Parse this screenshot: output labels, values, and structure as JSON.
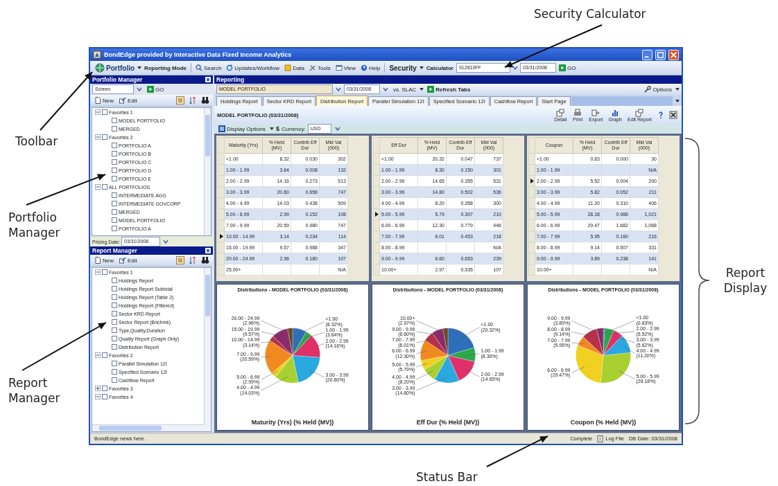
{
  "annotations": [
    {
      "text": "Security Calculator"
    },
    {
      "text": "Toolbar"
    },
    {
      "text": "Portfolio Manager"
    },
    {
      "text": "Report Manager"
    },
    {
      "text": "Report Display"
    },
    {
      "text": "Status Bar"
    }
  ],
  "window": {
    "title": "BondEdge provided by Interactive Data Fixed Income Analytics"
  },
  "toolbar": {
    "portfolio": "Portfolio",
    "mode": "Reporting Mode",
    "buttons": [
      {
        "label": "Search",
        "kind": "search"
      },
      {
        "label": "Updates/Workflow",
        "kind": "refresh"
      },
      {
        "label": "Data",
        "kind": "data"
      },
      {
        "label": "Tools",
        "kind": "tools"
      },
      {
        "label": "View",
        "kind": "view"
      },
      {
        "label": "Help",
        "kind": "help"
      }
    ],
    "security": "Security",
    "calculator": "Calculator",
    "security_value": "912810FF",
    "date_value": "03/31/2008",
    "go": "GO"
  },
  "portfolio_manager": {
    "title": "Portfolio Manager",
    "screen_value": "Screen",
    "go": "GO",
    "new": "New",
    "edit": "Edit",
    "tree": [
      {
        "label": "Favorites 1",
        "expanded": true,
        "checked": false,
        "children": [
          {
            "label": "MODEL PORTFOLIO",
            "checked": false
          },
          {
            "label": "MERGED",
            "checked": false
          }
        ]
      },
      {
        "label": "Favorites 2",
        "expanded": true,
        "checked": false,
        "children": [
          {
            "label": "PORTFOLIO A",
            "checked": false
          },
          {
            "label": "PORTFOLIO B",
            "checked": false
          },
          {
            "label": "PORTFOLIO C",
            "checked": false
          },
          {
            "label": "PORTFOLIO D",
            "checked": false
          },
          {
            "label": "PORTFOLIO E",
            "checked": false
          }
        ]
      },
      {
        "label": "ALL PORTFOLIOS",
        "expanded": true,
        "checked": false,
        "children": [
          {
            "label": "INTERMEDIATE AGG",
            "checked": false
          },
          {
            "label": "INTERMEDIATE GOVCORP",
            "checked": false
          },
          {
            "label": "MERGED",
            "checked": false
          },
          {
            "label": "MODEL PORTFOLIO",
            "checked": false
          },
          {
            "label": "PORTFOLIO A",
            "checked": false
          }
        ]
      }
    ],
    "pricing_label": "Pricing Date:",
    "pricing_value": "03/31/2008"
  },
  "report_manager": {
    "title": "Report Manager",
    "new": "New",
    "edit": "Edit",
    "tree": [
      {
        "label": "Favorites 1",
        "expanded": true,
        "checked": false,
        "children": [
          {
            "label": "Holdings Report",
            "checked": false
          },
          {
            "label": "Holdings Report Subtotal",
            "checked": false
          },
          {
            "label": "Holdings Report (Table 2)",
            "checked": false
          },
          {
            "label": "Holdings Report (Filtered)",
            "checked": false
          },
          {
            "label": "Sector KRD Report",
            "checked": false
          },
          {
            "label": "Sector Report (Bnchmk)",
            "checked": false
          },
          {
            "label": "Type,Quality,Duration",
            "checked": false
          },
          {
            "label": "Quality Report (Graph Only)",
            "checked": false
          },
          {
            "label": "Distribution Report",
            "checked": false
          }
        ]
      },
      {
        "label": "Favorites 2",
        "expanded": true,
        "checked": false,
        "children": [
          {
            "label": "Parallel Simulation 12I",
            "checked": false
          },
          {
            "label": "Specified Scenario 12I",
            "checked": false
          },
          {
            "label": "Cashflow Report",
            "checked": false
          }
        ]
      },
      {
        "label": "Favorites 3",
        "expanded": false,
        "checked": false
      },
      {
        "label": "Favorites 4",
        "expanded": true,
        "checked": false
      }
    ]
  },
  "reporting": {
    "title": "Reporting",
    "portfolio_value": "MODEL PORTFOLIO",
    "date_value": "03/31/2008",
    "vs": "vs. SLAC",
    "refresh": "Refresh Tabs",
    "options": "Options",
    "tabs": [
      {
        "label": "Holdings Report",
        "selected": false
      },
      {
        "label": "Sector KRD Report",
        "selected": false
      },
      {
        "label": "Distribution Report",
        "selected": true
      },
      {
        "label": "Parallel Simulation 12I",
        "selected": false
      },
      {
        "label": "Specified Scenario 12I",
        "selected": false
      },
      {
        "label": "Cashflow Report",
        "selected": false
      },
      {
        "label": "Start Page",
        "selected": false
      }
    ],
    "report_title": "MODEL PORTFOLIO (03/31/2008)",
    "actions": [
      {
        "label": "Detail",
        "kind": "detail"
      },
      {
        "label": "Print",
        "kind": "print"
      },
      {
        "label": "Export",
        "kind": "export"
      },
      {
        "label": "Graph",
        "kind": "graph"
      },
      {
        "label": "Edit Report",
        "kind": "edit"
      }
    ],
    "display_options": "Display Options",
    "currency_symbol": "$",
    "currency_label": "Currency:",
    "currency_value": "USD",
    "panels": [
      {
        "columns": [
          "Maturity (Yrs)",
          "% Held (MV)",
          "Contrib Eff Dur",
          "Mkt Val (000)"
        ],
        "rows": [
          {
            "selected": false,
            "cells": [
              "<1.00",
              "8.32",
              "0.030",
              "302"
            ]
          },
          {
            "selected": false,
            "cells": [
              "1.00 - 1.99",
              "3.64",
              "0.008",
              "132"
            ]
          },
          {
            "selected": false,
            "cells": [
              "2.00 - 2.99",
              "14.16",
              "0.273",
              "513"
            ]
          },
          {
            "selected": false,
            "cells": [
              "3.00 - 3.99",
              "20.60",
              "0.656",
              "747"
            ]
          },
          {
            "selected": false,
            "cells": [
              "4.00 - 4.99",
              "14.03",
              "0.438",
              "509"
            ]
          },
          {
            "selected": false,
            "cells": [
              "5.00 - 6.99",
              "2.99",
              "0.152",
              "108"
            ]
          },
          {
            "selected": false,
            "cells": [
              "7.00 - 9.99",
              "20.59",
              "0.980",
              "747"
            ]
          },
          {
            "selected": true,
            "cells": [
              "10.00 - 14.99",
              "3.14",
              "0.234",
              "114"
            ]
          },
          {
            "selected": false,
            "cells": [
              "15.00 - 19.99",
              "9.57",
              "0.988",
              "347"
            ]
          },
          {
            "selected": false,
            "cells": [
              "20.00 - 24.99",
              "2.96",
              "0.180",
              "107"
            ]
          },
          {
            "selected": false,
            "cells": [
              "25.00+",
              null,
              null,
              "N/A"
            ]
          }
        ],
        "chart_data": {
          "type": "pie",
          "title": "Distributions - MODEL PORTFOLIO (03/31/2008)",
          "xlabel": "Maturity (Yrs) (% Held (MV))",
          "categories": [
            "<1.00",
            "1.00 - 1.99",
            "2.00 - 2.99",
            "3.00 - 3.99",
            "4.00 - 4.99",
            "5.00 - 6.99",
            "7.00 - 9.99",
            "10.00 - 14.99",
            "15.00 - 19.99",
            "20.00 - 24.99"
          ],
          "values": [
            8.32,
            3.64,
            14.16,
            20.6,
            14.03,
            2.99,
            20.59,
            3.14,
            9.57,
            2.96
          ],
          "value_labels": [
            "(8.32%)",
            "(3.64%)",
            "(14.16%)",
            "(20.60%)",
            "(14.03%)",
            "(2.99%)",
            "(20.59%)",
            "(3.14%)",
            "(9.57%)",
            "(2.96%)"
          ]
        }
      },
      {
        "columns": [
          "Eff Dur",
          "% Held (MV)",
          "Contrib Eff Dur",
          "Mkt Val (000)"
        ],
        "rows": [
          {
            "selected": false,
            "cells": [
              "<1.00",
              "20.32",
              "0.047",
              "737"
            ]
          },
          {
            "selected": false,
            "cells": [
              "1.00 - 1.99",
              "8.30",
              "0.150",
              "301"
            ]
          },
          {
            "selected": false,
            "cells": [
              "2.00 - 2.99",
              "14.65",
              "0.355",
              "531"
            ]
          },
          {
            "selected": false,
            "cells": [
              "3.00 - 3.99",
              "14.80",
              "0.502",
              "536"
            ]
          },
          {
            "selected": false,
            "cells": [
              "4.00 - 4.99",
              "8.20",
              "0.358",
              "300"
            ]
          },
          {
            "selected": true,
            "cells": [
              "5.00 - 5.99",
              "5.79",
              "0.307",
              "210"
            ]
          },
          {
            "selected": false,
            "cells": [
              "6.00 - 6.99",
              "12.30",
              "0.779",
              "446"
            ]
          },
          {
            "selected": false,
            "cells": [
              "7.00 - 7.99",
              "6.01",
              "0.453",
              "218"
            ]
          },
          {
            "selected": false,
            "cells": [
              "8.00 - 8.99",
              null,
              null,
              "N/A"
            ]
          },
          {
            "selected": false,
            "cells": [
              "9.00 - 9.99",
              "6.60",
              "0.653",
              "239"
            ]
          },
          {
            "selected": false,
            "cells": [
              "10.00+",
              "2.97",
              "0.335",
              "107"
            ]
          }
        ],
        "chart_data": {
          "type": "pie",
          "title": "Distributions - MODEL PORTFOLIO (03/31/2008)",
          "xlabel": "Eff Dur (% Held (MV))",
          "categories": [
            "<1.00",
            "1.00 - 1.99",
            "2.00 - 2.99",
            "3.00 - 3.99",
            "4.00 - 4.99",
            "5.00 - 5.99",
            "6.00 - 6.99",
            "7.00 - 7.99",
            "9.00 - 9.99",
            "10.00+"
          ],
          "values": [
            20.32,
            8.3,
            14.65,
            14.8,
            8.2,
            5.79,
            12.3,
            6.01,
            6.6,
            2.97
          ],
          "value_labels": [
            "(20.32%)",
            "(8.30%)",
            "(14.65%)",
            "(14.80%)",
            "(8.20%)",
            "(5.79%)",
            "(12.30%)",
            "(6.01%)",
            "(6.60%)",
            "(2.97%)"
          ]
        }
      },
      {
        "columns": [
          "Coupon",
          "% Held (MV)",
          "Contrib Eff Dur",
          "Mkt Val (000)"
        ],
        "rows": [
          {
            "selected": false,
            "cells": [
              "<1.00",
              "0.83",
              "0.000",
              "30"
            ]
          },
          {
            "selected": false,
            "cells": [
              "1.00 - 1.99",
              null,
              null,
              "N/A"
            ]
          },
          {
            "selected": true,
            "cells": [
              "2.00 - 2.99",
              "5.52",
              "0.004",
              "200"
            ]
          },
          {
            "selected": false,
            "cells": [
              "3.00 - 3.99",
              "5.82",
              "0.052",
              "211"
            ]
          },
          {
            "selected": false,
            "cells": [
              "4.00 - 4.99",
              "11.20",
              "0.310",
              "406"
            ]
          },
          {
            "selected": false,
            "cells": [
              "5.00 - 5.99",
              "28.18",
              "0.986",
              "1,021"
            ]
          },
          {
            "selected": false,
            "cells": [
              "6.00 - 6.99",
              "29.47",
              "1.682",
              "1,068"
            ]
          },
          {
            "selected": false,
            "cells": [
              "7.00 - 7.99",
              "5.95",
              "0.160",
              "216"
            ]
          },
          {
            "selected": false,
            "cells": [
              "8.00 - 8.99",
              "9.14",
              "0.507",
              "331"
            ]
          },
          {
            "selected": false,
            "cells": [
              "9.00 - 9.99",
              "3.89",
              "0.238",
              "141"
            ]
          },
          {
            "selected": false,
            "cells": [
              "10.00+",
              null,
              null,
              "N/A"
            ]
          }
        ],
        "chart_data": {
          "type": "pie",
          "title": "Distributions - MODEL PORTFOLIO (03/31/2008)",
          "xlabel": "Coupon (% Held (MV))",
          "categories": [
            "<1.00",
            "2.00 - 2.99",
            "3.00 - 3.99",
            "4.00 - 4.99",
            "5.00 - 5.99",
            "6.00 - 6.99",
            "7.00 - 7.99",
            "8.00 - 8.99",
            "9.00 - 9.99"
          ],
          "values": [
            0.83,
            5.52,
            5.82,
            11.2,
            28.18,
            29.47,
            5.95,
            9.14,
            3.89
          ],
          "value_labels": [
            "(0.83%)",
            "(5.52%)",
            "(5.82%)",
            "(11.20%)",
            "(28.18%)",
            "(29.47%)",
            "(5.95%)",
            "(9.14%)",
            "(3.89%)"
          ]
        }
      }
    ]
  },
  "status_bar": {
    "news": "BondEdge news here.",
    "state": "Complete",
    "log": "Log File",
    "db_date": "DB Date: 03/31/2008"
  }
}
